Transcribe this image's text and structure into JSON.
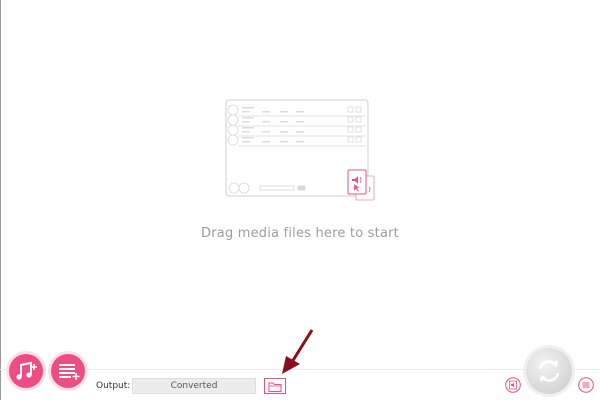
{
  "drop_zone": {
    "hint": "Drag media files here to start"
  },
  "output": {
    "label": "Output:",
    "folder_value": "Converted"
  },
  "icons": {
    "add_audio": "music-note-plus-icon",
    "add_list": "playlist-plus-icon",
    "open_folder": "folder-icon",
    "convert": "refresh-cycle-icon",
    "audio_settings": "speaker-doc-icon",
    "menu": "layers-menu-icon"
  },
  "colors": {
    "accent": "#ee4d84",
    "accent_light": "#fbe0ea",
    "arrow": "#8b0d1e",
    "text_muted": "#9c9ca4"
  }
}
